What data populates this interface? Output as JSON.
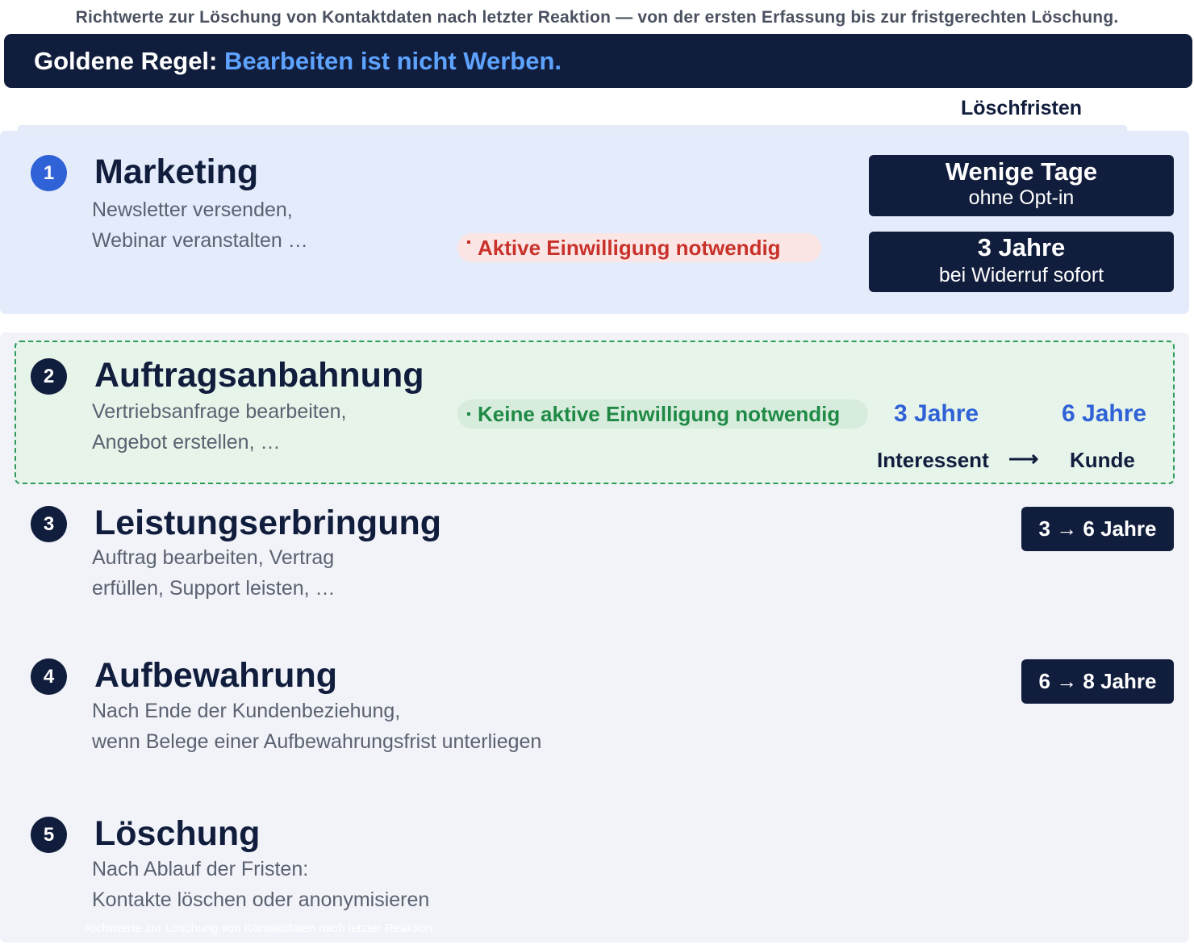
{
  "header": {
    "caption": "Richtwerte zur Löschung von Kontaktdaten nach letzter Reaktion — von der ersten Erfassung bis zur fristgerechten Löschung.",
    "rule_prefix": "Goldene Regel:",
    "rule_text": "Bearbeiten ist nicht Werben.",
    "column_header": "Löschfristen"
  },
  "steps": [
    {
      "number": "1",
      "title": "Marketing",
      "desc_line1": "Newsletter versenden,",
      "desc_line2": "Webinar veranstalten …",
      "consent": "Aktive Einwilligung notwendig",
      "badge1_big": "Wenige Tage",
      "badge1_small": "ohne Opt-in",
      "badge2_big": "3 Jahre",
      "badge2_small": "bei Widerruf sofort"
    },
    {
      "number": "2",
      "title": "Auftragsanbahnung",
      "desc_line1": "Vertriebsanfrage bearbeiten,",
      "desc_line2": "Angebot erstellen, …",
      "consent": "Keine aktive Einwilligung notwendig",
      "period_a": "3 Jahre",
      "period_b": "6 Jahre",
      "label_a": "Interessent",
      "arrow": "⟶",
      "label_b": "Kunde"
    },
    {
      "number": "3",
      "title": "Leistungserbringung",
      "desc_line1": "Auftrag bearbeiten, Vertrag",
      "desc_line2": "erfüllen, Support leisten, …",
      "badge": "3 → 6 Jahre"
    },
    {
      "number": "4",
      "title": "Aufbewahrung",
      "desc_line1": "Nach Ende der Kundenbeziehung,",
      "desc_line2": "wenn Belege einer Aufbewahrungsfrist unterliegen",
      "badge": "6 → 8 Jahre"
    },
    {
      "number": "5",
      "title": "Löschung",
      "desc_line1": "Nach Ablauf der Fristen:",
      "desc_line2": "Kontakte löschen oder anonymisieren"
    }
  ],
  "footer_note": "Richtwerte zur Löschung von Kontaktdaten nach letzter Reaktion",
  "colors": {
    "navy": "#111d3c",
    "accent_blue": "#2f62d6",
    "consent_required_red": "#c8322a",
    "consent_not_required_green": "#1f8a45"
  }
}
